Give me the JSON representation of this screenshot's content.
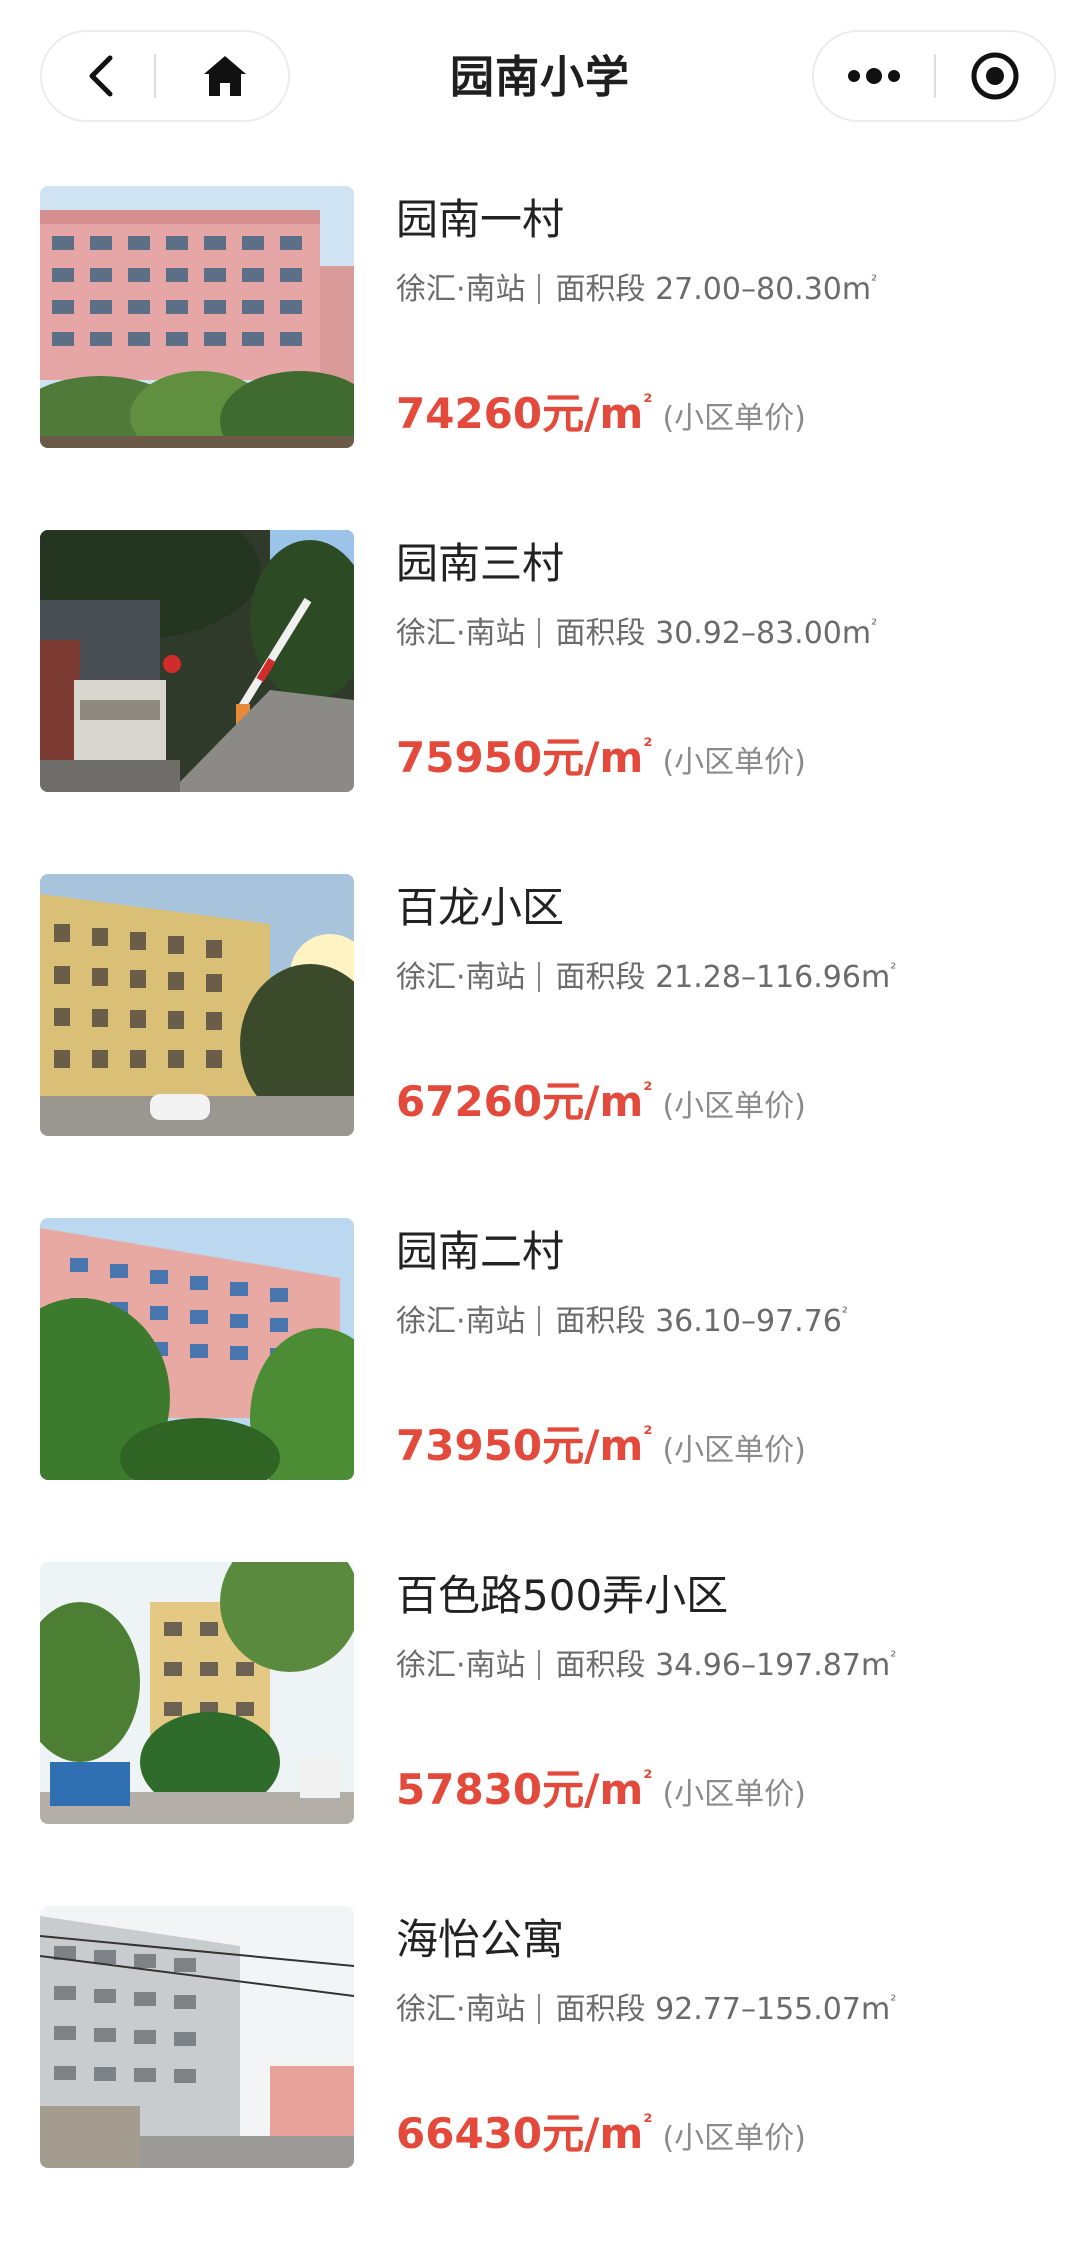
{
  "nav": {
    "title": "园南小学",
    "back_icon": "chevron-left-icon",
    "home_icon": "home-icon",
    "more_icon": "more-dots-icon",
    "close_icon": "target-close-icon"
  },
  "price_note": "(小区单价)",
  "price_unit": "元/m",
  "area_unit": "m",
  "superscript": "²",
  "area_label": "面积段",
  "listings": [
    {
      "name": "园南一村",
      "location": "徐汇·南站",
      "area_range": "27.00–80.30",
      "price": "74260"
    },
    {
      "name": "园南三村",
      "location": "徐汇·南站",
      "area_range": "30.92–83.00",
      "price": "75950"
    },
    {
      "name": "百龙小区",
      "location": "徐汇·南站",
      "area_range": "21.28–116.96",
      "price": "67260"
    },
    {
      "name": "园南二村",
      "location": "徐汇·南站",
      "area_range": "36.10–97.76",
      "price": "73950"
    },
    {
      "name": "百色路500弄小区",
      "location": "徐汇·南站",
      "area_range": "34.96–197.87",
      "price": "57830"
    },
    {
      "name": "海怡公寓",
      "location": "徐汇·南站",
      "area_range": "92.77–155.07",
      "price": "66430"
    }
  ],
  "colors": {
    "price": "#e44a3c",
    "meta_text": "#6b6b6b",
    "note_text": "#8a8a8a"
  }
}
